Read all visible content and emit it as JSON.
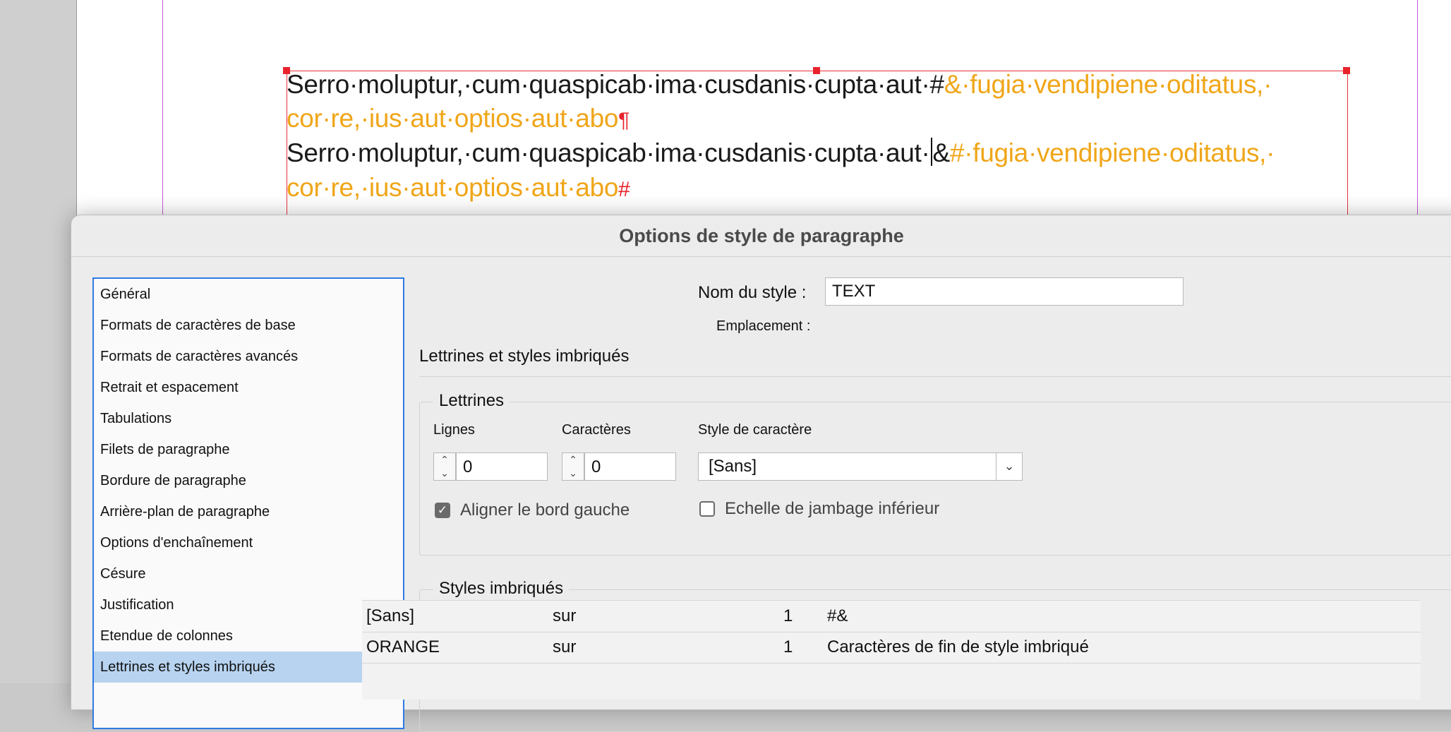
{
  "document": {
    "line1_black": "Serro·moluptur,·cum·quaspicab·ima·cusdanis·cupta·aut·#",
    "line1_orange": "&·fugia·vendipiene·oditatus,·",
    "line2_orange": "cor·re,·ius·aut·optios·aut·abo",
    "line2_mark": "¶",
    "line3_black": "Serro·moluptur,·cum·quaspicab·ima·cusdanis·cupta·aut·",
    "line3_black_after_caret": "&",
    "line3_orange": "#·fugia·vendipiene·oditatus,·",
    "line4_orange": "cor·re,·ius·aut·optios·aut·abo",
    "line4_mark": "#"
  },
  "dialog": {
    "title": "Options de style de paragraphe",
    "categories": [
      "Général",
      "Formats de caractères de base",
      "Formats de caractères avancés",
      "Retrait et espacement",
      "Tabulations",
      "Filets de paragraphe",
      "Bordure de paragraphe",
      "Arrière-plan de paragraphe",
      "Options d'enchaînement",
      "Césure",
      "Justification",
      "Etendue de colonnes",
      "Lettrines et styles imbriqués"
    ],
    "style_name_label": "Nom du style :",
    "style_name_value": "TEXT",
    "location_label": "Emplacement :",
    "section_title": "Lettrines et styles imbriqués",
    "dropcaps": {
      "group_title": "Lettrines",
      "lines_label": "Lignes",
      "lines_value": "0",
      "chars_label": "Caractères",
      "chars_value": "0",
      "charstyle_label": "Style de caractère",
      "charstyle_value": "[Sans]",
      "align_left_label": "Aligner le bord gauche",
      "align_left_checked": true,
      "descender_label": "Echelle de jambage inférieur",
      "descender_checked": false
    },
    "nested": {
      "group_title": "Styles imbriqués",
      "rows": [
        {
          "style": "[Sans]",
          "mode": "sur",
          "count": "1",
          "delimiter": "#&"
        },
        {
          "style": "ORANGE",
          "mode": "sur",
          "count": "1",
          "delimiter": "Caractères de fin de style imbriqué"
        }
      ]
    }
  },
  "colors": {
    "orange_text": "#f0a619",
    "frame_red": "#e8232c",
    "selection_blue": "#b7d3f0",
    "focus_blue": "#2f7ae5"
  },
  "icons": {
    "stepper": "stepper-icon",
    "dropdown": "chevron-down-icon",
    "checkbox": "checkmark-icon"
  }
}
